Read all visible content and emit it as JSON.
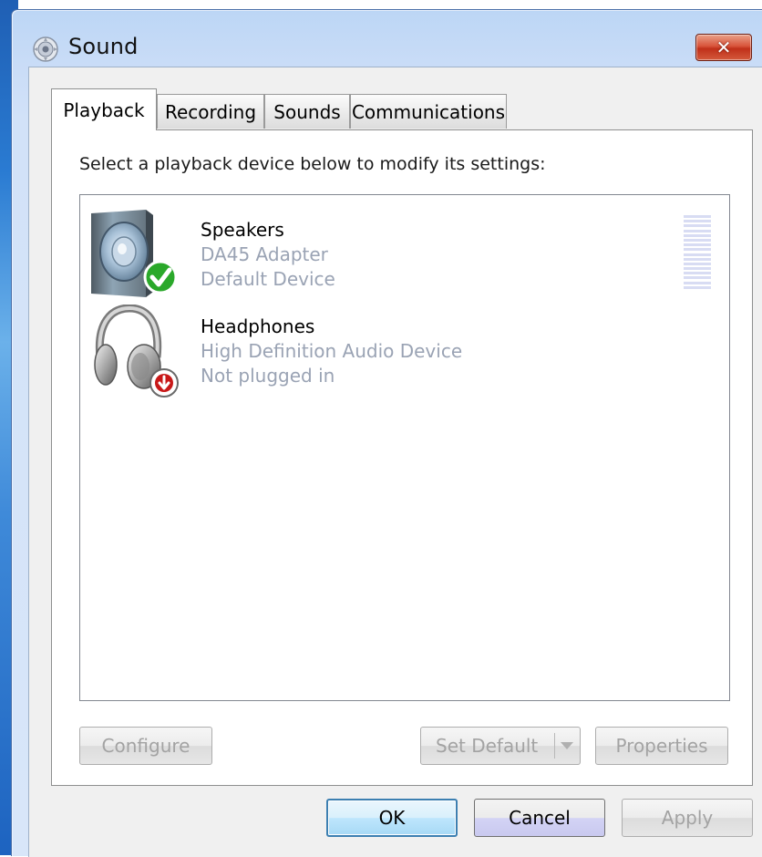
{
  "window": {
    "title": "Sound",
    "close_symbol": "✕",
    "icon": "speaker-icon"
  },
  "tabs": [
    {
      "label": "Playback",
      "active": true
    },
    {
      "label": "Recording",
      "active": false
    },
    {
      "label": "Sounds",
      "active": false
    },
    {
      "label": "Communications",
      "active": false
    }
  ],
  "playback": {
    "instruction": "Select a playback device below to modify its settings:",
    "devices": [
      {
        "name": "Speakers",
        "line1": "DA45 Adapter",
        "line2": "Default Device",
        "icon": "speaker-icon",
        "badge_icon": "green-check-icon",
        "level": 0
      },
      {
        "name": "Headphones",
        "line1": "High Definition Audio Device",
        "line2": "Not plugged in",
        "icon": "headphones-icon",
        "badge_icon": "red-down-arrow-icon"
      }
    ],
    "buttons": {
      "configure": "Configure",
      "set_default": "Set Default",
      "properties": "Properties"
    }
  },
  "footer": {
    "ok": "OK",
    "cancel": "Cancel",
    "apply": "Apply"
  },
  "colors": {
    "secondary_text": "#9aa3b4",
    "check_green": "#2aa82a",
    "unplugged_red": "#c81818",
    "default_button_border": "#3c7fb1"
  }
}
